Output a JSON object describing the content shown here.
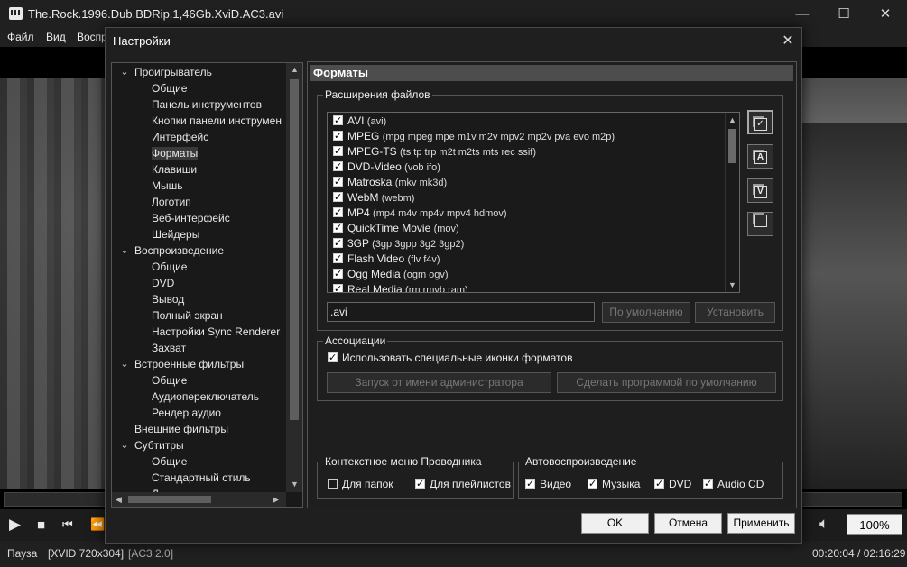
{
  "player": {
    "title": "The.Rock.1996.Dub.BDRip.1,46Gb.XviD.AC3.avi",
    "window_controls": {
      "minimize": "—",
      "maximize": "☐",
      "close": "✕"
    },
    "menu": [
      "Файл",
      "Вид",
      "Воспр"
    ],
    "volume": "100%",
    "status": {
      "state": "Пауза",
      "video": "[XVID 720x304]",
      "audio": "[AC3 2.0]",
      "time": "00:20:04 / 02:16:29"
    }
  },
  "dialog": {
    "title": "Настройки",
    "close": "✕",
    "tree": [
      {
        "label": "Проигрыватель",
        "level": 0,
        "expanded": true
      },
      {
        "label": "Общие",
        "level": 1
      },
      {
        "label": "Панель инструментов",
        "level": 1
      },
      {
        "label": "Кнопки панели инструмен",
        "level": 1
      },
      {
        "label": "Интерфейс",
        "level": 1
      },
      {
        "label": "Форматы",
        "level": 1,
        "selected": true
      },
      {
        "label": "Клавиши",
        "level": 1
      },
      {
        "label": "Мышь",
        "level": 1
      },
      {
        "label": "Логотип",
        "level": 1
      },
      {
        "label": "Веб-интерфейс",
        "level": 1
      },
      {
        "label": "Шейдеры",
        "level": 1
      },
      {
        "label": "Воспроизведение",
        "level": 0,
        "expanded": true
      },
      {
        "label": "Общие",
        "level": 1
      },
      {
        "label": "DVD",
        "level": 1
      },
      {
        "label": "Вывод",
        "level": 1
      },
      {
        "label": "Полный экран",
        "level": 1
      },
      {
        "label": "Настройки Sync Renderer",
        "level": 1
      },
      {
        "label": "Захват",
        "level": 1
      },
      {
        "label": "Встроенные фильтры",
        "level": 0,
        "expanded": true
      },
      {
        "label": "Общие",
        "level": 1
      },
      {
        "label": "Аудиопереключатель",
        "level": 1
      },
      {
        "label": "Рендер аудио",
        "level": 1
      },
      {
        "label": "Внешние фильтры",
        "level": 0
      },
      {
        "label": "Субтитры",
        "level": 0,
        "expanded": true
      },
      {
        "label": "Общие",
        "level": 1
      },
      {
        "label": "Стандартный стиль",
        "level": 1
      },
      {
        "label": "Д",
        "level": 1
      }
    ],
    "page_title": "Форматы",
    "extensions_group": "Расширения файлов",
    "formats": [
      {
        "name": "AVI",
        "exts": "(avi)",
        "checked": true
      },
      {
        "name": "MPEG",
        "exts": "(mpg mpeg mpe m1v m2v mpv2 mp2v pva evo m2p)",
        "checked": true
      },
      {
        "name": "MPEG-TS",
        "exts": "(ts tp trp m2t m2ts mts rec ssif)",
        "checked": true
      },
      {
        "name": "DVD-Video",
        "exts": "(vob ifo)",
        "checked": true
      },
      {
        "name": "Matroska",
        "exts": "(mkv mk3d)",
        "checked": true
      },
      {
        "name": "WebM",
        "exts": "(webm)",
        "checked": true
      },
      {
        "name": "MP4",
        "exts": "(mp4 m4v mp4v mpv4 hdmov)",
        "checked": true
      },
      {
        "name": "QuickTime Movie",
        "exts": "(mov)",
        "checked": true
      },
      {
        "name": "3GP",
        "exts": "(3gp 3gpp 3g2 3gp2)",
        "checked": true
      },
      {
        "name": "Flash Video",
        "exts": "(flv f4v)",
        "checked": true
      },
      {
        "name": "Ogg Media",
        "exts": "(ogm ogv)",
        "checked": true
      },
      {
        "name": "Real Media",
        "exts": "(rm rmvb ram)",
        "checked": true
      }
    ],
    "side_buttons": [
      {
        "name": "select-all-icon",
        "glyph": "✓"
      },
      {
        "name": "select-audio-icon",
        "glyph": "A"
      },
      {
        "name": "select-video-icon",
        "glyph": "V"
      },
      {
        "name": "select-none-icon",
        "glyph": ""
      }
    ],
    "ext_value": ".avi",
    "default_button": "По умолчанию",
    "set_button": "Установить",
    "associations_group": "Ассоциации",
    "special_icons": "Использовать специальные иконки форматов",
    "run_as_admin": "Запуск от имени администратора",
    "make_default": "Сделать программой по умолчанию",
    "context_group": "Контекстное меню Проводника",
    "for_folders": "Для папок",
    "for_playlists": "Для плейлистов",
    "autoplay_group": "Автовоспроизведение",
    "autoplay": {
      "video": "Видео",
      "music": "Музыка",
      "dvd": "DVD",
      "audiocd": "Audio CD"
    },
    "ok": "OK",
    "cancel": "Отмена",
    "apply": "Применить"
  }
}
